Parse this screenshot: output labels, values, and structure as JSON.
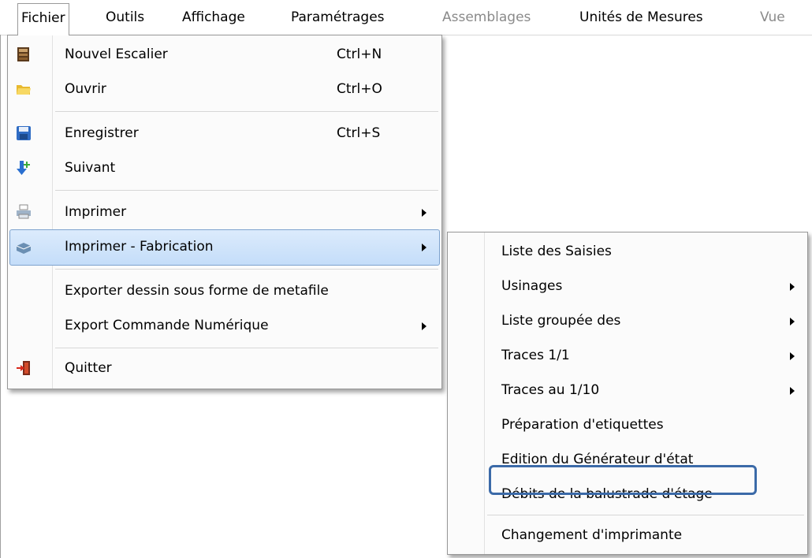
{
  "menubar": {
    "items": [
      {
        "label": "Fichier",
        "state": "open"
      },
      {
        "label": "Outils",
        "state": "normal"
      },
      {
        "label": "Affichage",
        "state": "normal"
      },
      {
        "label": "Paramétrages",
        "state": "normal"
      },
      {
        "label": "Assemblages",
        "state": "disabled"
      },
      {
        "label": "Unités de Mesures",
        "state": "normal"
      },
      {
        "label": "Vue",
        "state": "disabled"
      }
    ]
  },
  "file_menu": {
    "items": [
      {
        "label": "Nouvel Escalier",
        "shortcut": "Ctrl+N",
        "icon": "new-stair-icon"
      },
      {
        "label": "Ouvrir",
        "shortcut": "Ctrl+O",
        "icon": "folder-open-icon"
      },
      {
        "label": "Enregistrer",
        "shortcut": "Ctrl+S",
        "icon": "floppy-disk-icon"
      },
      {
        "label": "Suivant",
        "shortcut": "",
        "icon": "next-arrow-icon"
      },
      {
        "label": "Imprimer",
        "shortcut": "",
        "icon": "printer-icon",
        "submenu": true
      },
      {
        "label": "Imprimer - Fabrication",
        "shortcut": "",
        "icon": "printer-fabrication-icon",
        "submenu": true,
        "highlighted": true
      },
      {
        "label": "Exporter dessin sous forme de metafile",
        "shortcut": ""
      },
      {
        "label": "Export Commande Numérique",
        "shortcut": "",
        "submenu": true
      },
      {
        "label": "Quitter",
        "shortcut": "",
        "icon": "exit-door-icon"
      }
    ]
  },
  "fabrication_submenu": {
    "items": [
      {
        "label": "Liste des Saisies"
      },
      {
        "label": "Usinages",
        "submenu": true
      },
      {
        "label": "Liste groupée des",
        "submenu": true
      },
      {
        "label": "Traces 1/1",
        "submenu": true
      },
      {
        "label": "Traces au 1/10",
        "submenu": true
      },
      {
        "label": "Préparation d'etiquettes"
      },
      {
        "label": "Edition du Générateur d'état"
      },
      {
        "label": "Débits de la balustrade d'étage",
        "annotated": true
      },
      {
        "label": "Changement d'imprimante"
      }
    ]
  },
  "colors": {
    "highlight": "#c4ddf9",
    "highlight_border": "#7da2ce",
    "annotation": "#3b6aa8"
  }
}
